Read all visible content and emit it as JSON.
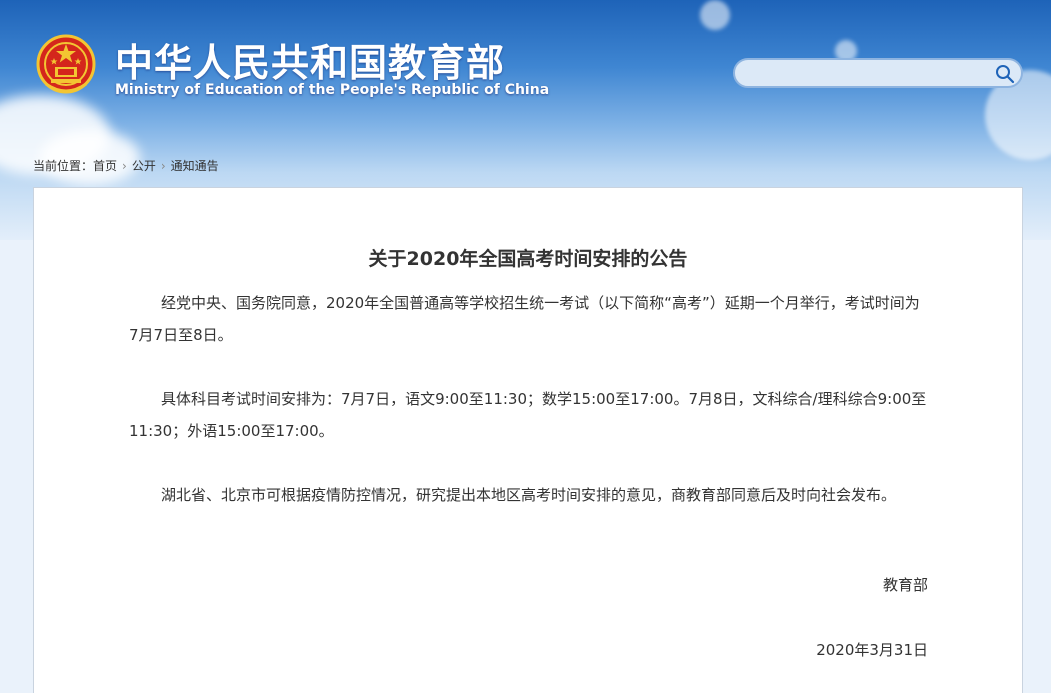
{
  "header": {
    "site_title": "中华人民共和国教育部",
    "site_subtitle": "Ministry of Education of the People's Republic of China",
    "search_placeholder": ""
  },
  "breadcrumb": {
    "prefix": "当前位置：",
    "items": [
      "首页",
      "公开",
      "通知通告"
    ]
  },
  "article": {
    "title": "关于2020年全国高考时间安排的公告",
    "paragraphs": [
      "经党中央、国务院同意，2020年全国普通高等学校招生统一考试（以下简称“高考”）延期一个月举行，考试时间为7月7日至8日。",
      "具体科目考试时间安排为：7月7日，语文9:00至11:30；数学15:00至17:00。7月8日，文科综合/理科综合9:00至11:30；外语15:00至17:00。",
      "湖北省、北京市可根据疫情防控情况，研究提出本地区高考时间安排的意见，商教育部同意后及时向社会发布。"
    ],
    "signer": "教育部",
    "date": "2020年3月31日"
  },
  "colors": {
    "header_blue": "#1e63b8",
    "emblem_red": "#d4261c",
    "emblem_gold": "#f3c532"
  }
}
